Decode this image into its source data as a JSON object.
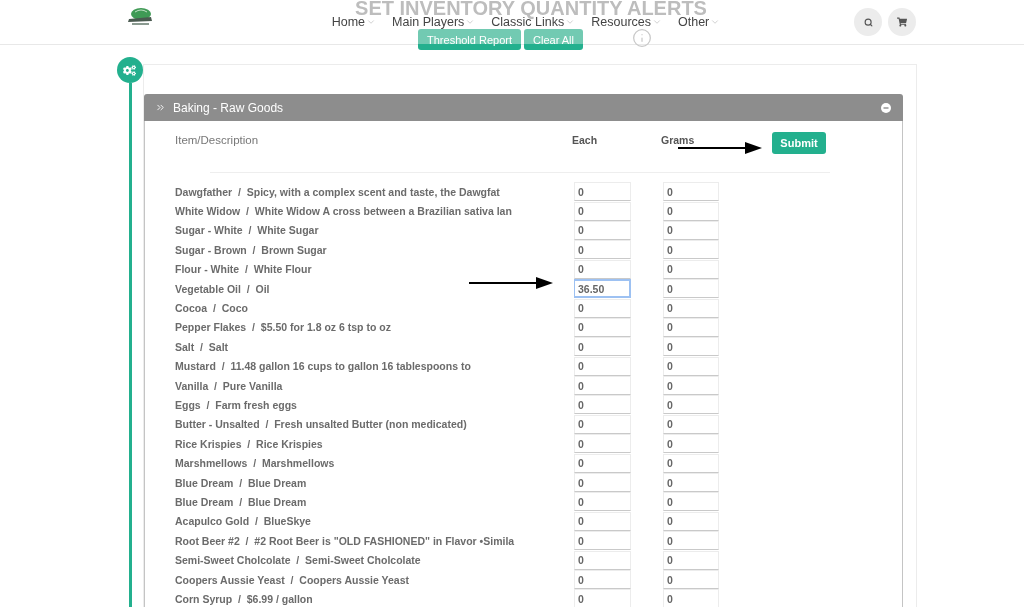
{
  "header": {
    "nav_items": [
      "Home",
      "Main Players",
      "Classic Links",
      "Resources",
      "Other"
    ]
  },
  "page": {
    "title": "SET INVENTORY QUANTITY ALERTS",
    "actions": [
      "Threshold Report",
      "Clear All"
    ]
  },
  "panel": {
    "title": "Baking - Raw Goods",
    "expanded": true,
    "columns": [
      "Item/Description",
      "Each",
      "Grams"
    ],
    "submit": "Submit",
    "rows": [
      {
        "label": "Dawgfather  /  Spicy, with a complex scent and taste, the Dawgfat",
        "each": "0",
        "grams": "0",
        "focused": false
      },
      {
        "label": "White Widow  /  White Widow A cross between a Brazilian sativa lan",
        "each": "0",
        "grams": "0",
        "focused": false
      },
      {
        "label": "Sugar - White  /  White Sugar",
        "each": "0",
        "grams": "0",
        "focused": false
      },
      {
        "label": "Sugar - Brown  /  Brown Sugar",
        "each": "0",
        "grams": "0",
        "focused": false
      },
      {
        "label": "Flour - White  /  White Flour",
        "each": "0",
        "grams": "0",
        "focused": false
      },
      {
        "label": "Vegetable Oil  /  Oil",
        "each": "36.50",
        "grams": "0",
        "focused": true
      },
      {
        "label": "Cocoa  /  Coco",
        "each": "0",
        "grams": "0",
        "focused": false
      },
      {
        "label": "Pepper Flakes  /  $5.50 for 1.8 oz 6 tsp to oz",
        "each": "0",
        "grams": "0",
        "focused": false
      },
      {
        "label": "Salt  /  Salt",
        "each": "0",
        "grams": "0",
        "focused": false
      },
      {
        "label": "Mustard  /  11.48 gallon 16 cups to gallon 16 tablespoons to",
        "each": "0",
        "grams": "0",
        "focused": false
      },
      {
        "label": "Vanilla  /  Pure Vanilla",
        "each": "0",
        "grams": "0",
        "focused": false
      },
      {
        "label": "Eggs  /  Farm fresh eggs",
        "each": "0",
        "grams": "0",
        "focused": false
      },
      {
        "label": "Butter - Unsalted  /  Fresh unsalted Butter (non medicated)",
        "each": "0",
        "grams": "0",
        "focused": false
      },
      {
        "label": "Rice Krispies  /  Rice Krispies",
        "each": "0",
        "grams": "0",
        "focused": false
      },
      {
        "label": "Marshmellows  /  Marshmellows",
        "each": "0",
        "grams": "0",
        "focused": false
      },
      {
        "label": "Blue Dream  /  Blue Dream",
        "each": "0",
        "grams": "0",
        "focused": false
      },
      {
        "label": "Blue Dream  /  Blue Dream",
        "each": "0",
        "grams": "0",
        "focused": false
      },
      {
        "label": "Acapulco Gold  /  BlueSkye",
        "each": "0",
        "grams": "0",
        "focused": false
      },
      {
        "label": "Root Beer #2  /  #2 Root Beer is \"OLD FASHIONED\" in Flavor •Simila",
        "each": "0",
        "grams": "0",
        "focused": false
      },
      {
        "label": "Semi-Sweet Cholcolate  /  Semi-Sweet Cholcolate",
        "each": "0",
        "grams": "0",
        "focused": false
      },
      {
        "label": "Coopers Aussie Yeast  /  Coopers Aussie Yeast",
        "each": "0",
        "grams": "0",
        "focused": false
      },
      {
        "label": "Corn Syrup  /  $6.99 / gallon",
        "each": "0",
        "grams": "0",
        "focused": false
      }
    ]
  }
}
